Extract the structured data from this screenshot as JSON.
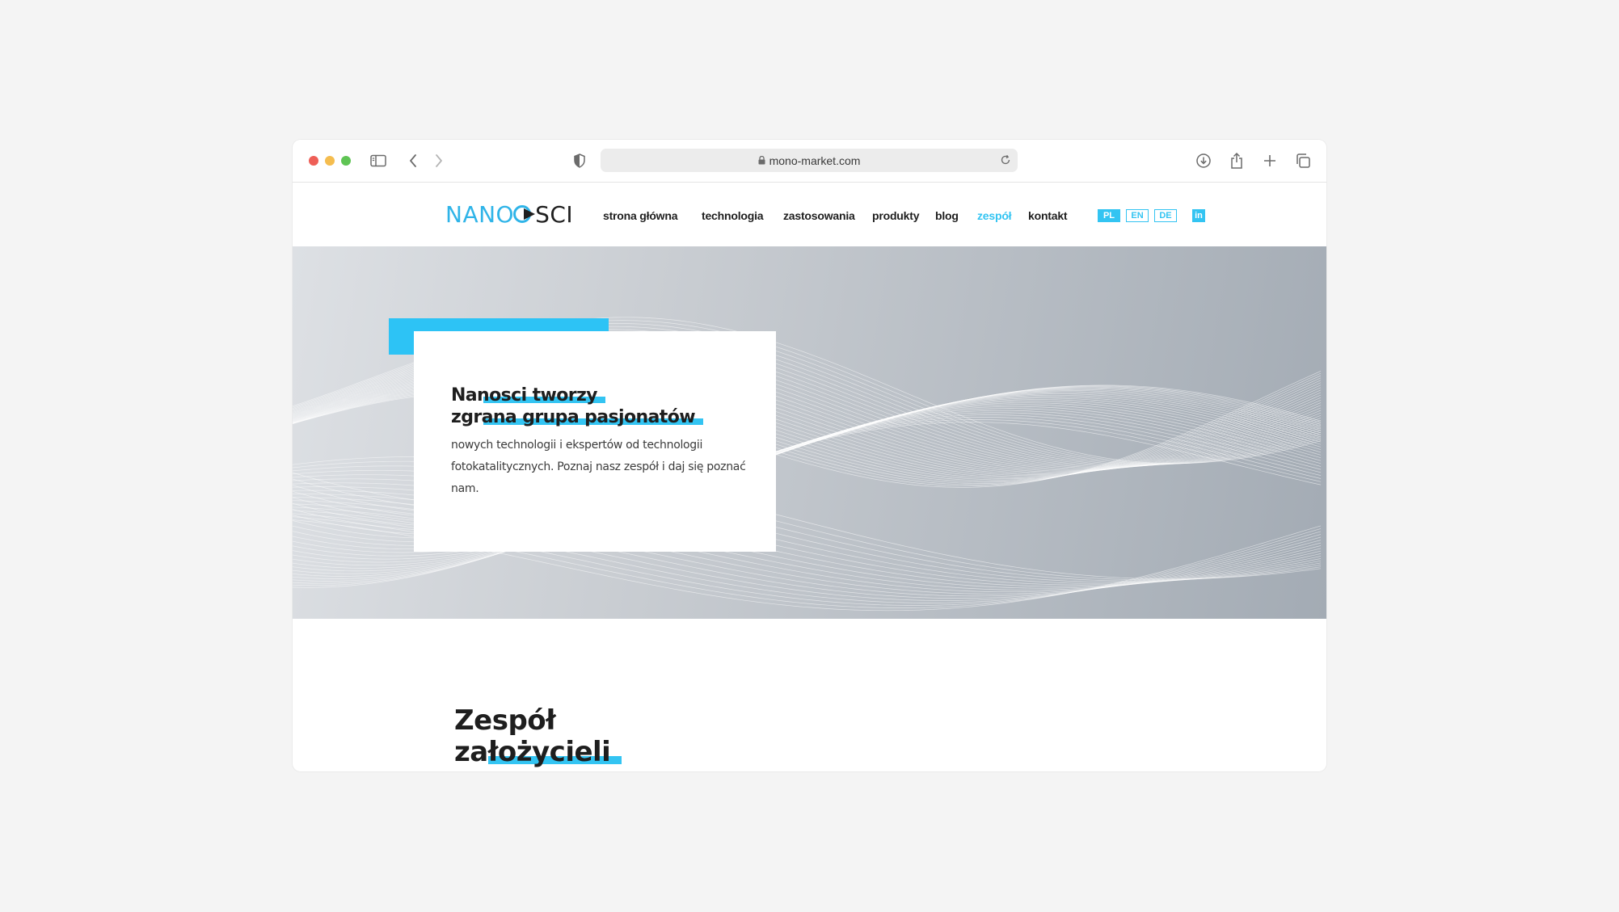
{
  "browser": {
    "url": "mono-market.com",
    "icons": {
      "sidebar": "sidebar-icon",
      "back": "chevron-left-icon",
      "forward": "chevron-right-icon",
      "privacy": "shield-icon",
      "lock": "lock-icon",
      "reload": "reload-icon",
      "download": "download-icon",
      "share": "share-icon",
      "new_tab": "plus-icon",
      "tabs": "tabs-overview-icon"
    }
  },
  "site": {
    "logo": {
      "part1": "NANO",
      "part2": "SCI"
    },
    "nav": [
      {
        "label": "strona główna",
        "active": false
      },
      {
        "label": "technologia",
        "active": false
      },
      {
        "label": "zastosowania",
        "active": false
      },
      {
        "label": "produkty",
        "active": false
      },
      {
        "label": "blog",
        "active": false
      },
      {
        "label": "zespół",
        "active": true
      },
      {
        "label": "kontakt",
        "active": false
      }
    ],
    "languages": [
      {
        "code": "PL",
        "active": true
      },
      {
        "code": "EN",
        "active": false
      },
      {
        "code": "DE",
        "active": false
      }
    ],
    "social": {
      "linkedin": "in"
    },
    "colors": {
      "accent": "#33c4f2",
      "text": "#1e1e1e"
    }
  },
  "hero": {
    "title_line1": "Nanosci tworzy",
    "title_line2": "zgrana grupa pasjonatów",
    "description": "nowych technologii i ekspertów od technologii fotokatalitycznych. Poznaj nasz zespół i daj się poznać nam."
  },
  "section": {
    "title_line1": "Zespół",
    "title_line2": "założycieli"
  }
}
